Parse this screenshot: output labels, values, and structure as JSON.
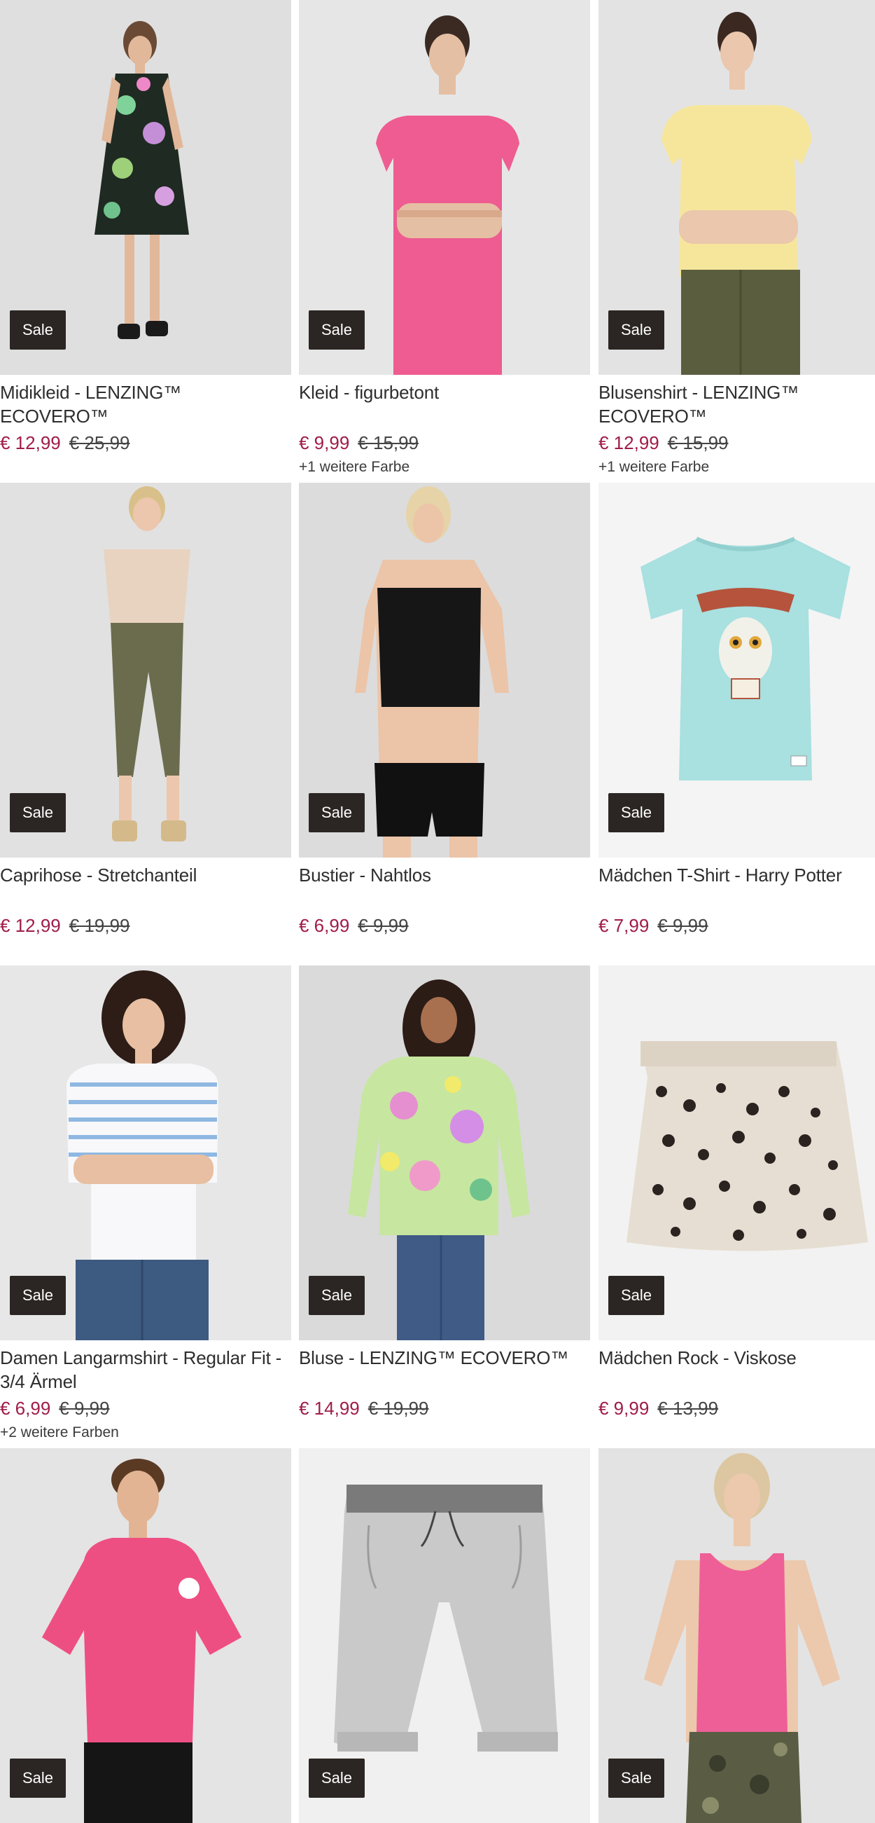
{
  "products": [
    {
      "name": "Midikleid - LENZING™ ECOVERO™",
      "badge": "Sale",
      "price": "€ 12,99",
      "old_price": "€ 25,99",
      "colors": ""
    },
    {
      "name": "Kleid - figurbetont",
      "badge": "Sale",
      "price": "€ 9,99",
      "old_price": "€ 15,99",
      "colors": "+1 weitere Farbe"
    },
    {
      "name": "Blusenshirt - LENZING™ ECOVERO™",
      "badge": "Sale",
      "price": "€ 12,99",
      "old_price": "€ 15,99",
      "colors": "+1 weitere Farbe"
    },
    {
      "name": "Caprihose - Stretchanteil",
      "badge": "Sale",
      "price": "€ 12,99",
      "old_price": "€ 19,99",
      "colors": ""
    },
    {
      "name": "Bustier - Nahtlos",
      "badge": "Sale",
      "price": "€ 6,99",
      "old_price": "€ 9,99",
      "colors": ""
    },
    {
      "name": "Mädchen T-Shirt - Harry Potter",
      "badge": "Sale",
      "price": "€ 7,99",
      "old_price": "€ 9,99",
      "colors": ""
    },
    {
      "name": "Damen Langarmshirt - Regular Fit - 3/4 Ärmel",
      "badge": "Sale",
      "price": "€ 6,99",
      "old_price": "€ 9,99",
      "colors": "+2 weitere Farben"
    },
    {
      "name": "Bluse - LENZING™ ECOVERO™",
      "badge": "Sale",
      "price": "€ 14,99",
      "old_price": "€ 19,99",
      "colors": ""
    },
    {
      "name": "Mädchen Rock - Viskose",
      "badge": "Sale",
      "price": "€ 9,99",
      "old_price": "€ 13,99",
      "colors": ""
    },
    {
      "badge": "Sale"
    },
    {
      "badge": "Sale"
    },
    {
      "badge": "Sale"
    }
  ],
  "colors": {
    "price": "#a01c4a",
    "badge_bg": "#2b2623",
    "image_bg": "#e4e4e4"
  }
}
